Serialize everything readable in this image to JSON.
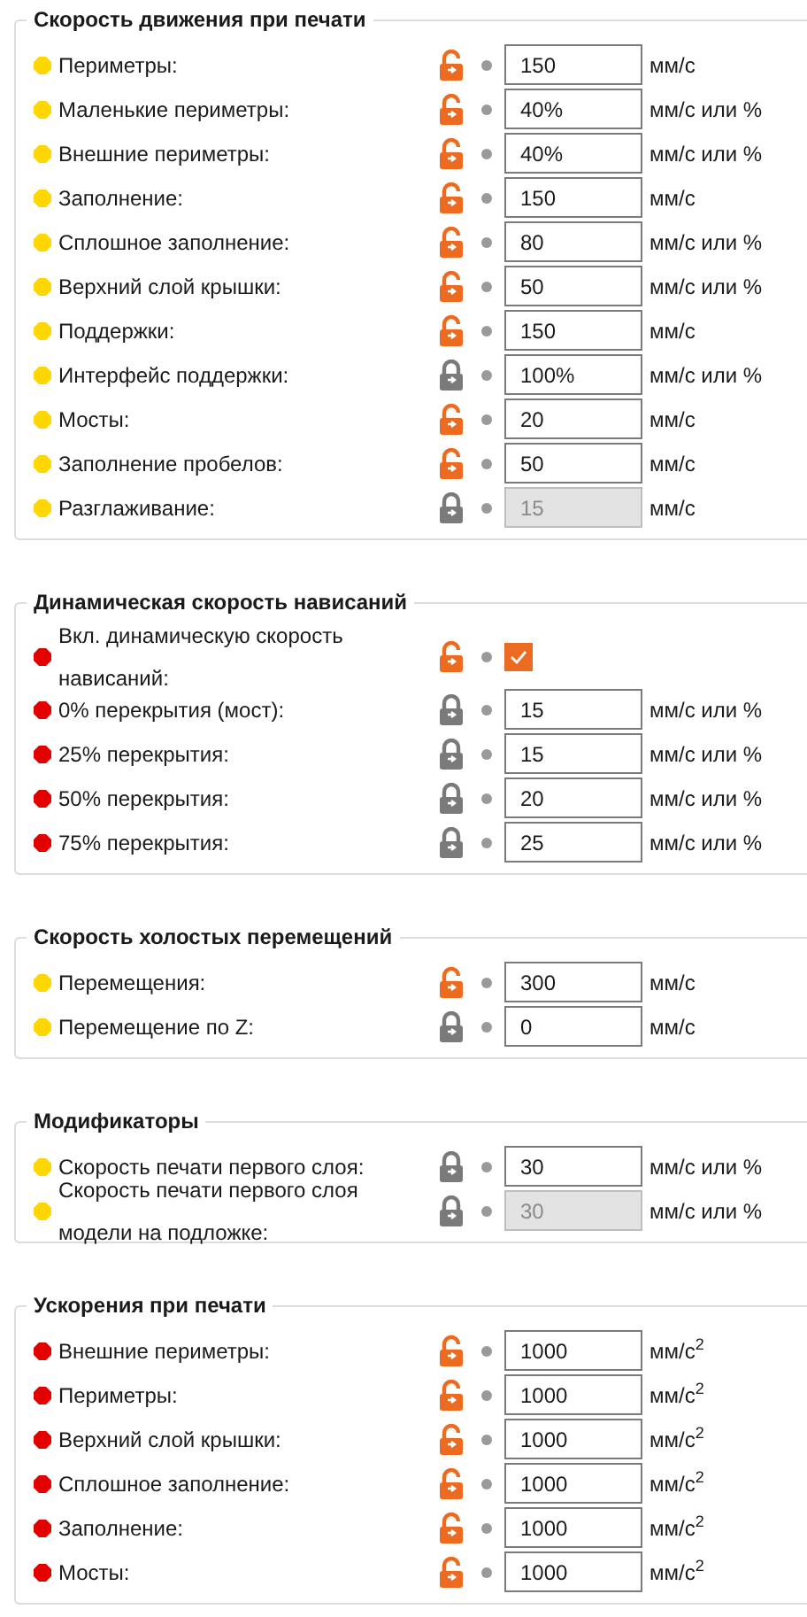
{
  "sections": [
    {
      "title": "Скорость движения при печати",
      "rows": [
        {
          "kind": "field",
          "label": "Периметры:",
          "color": "#ffd700",
          "locked": false,
          "value": "150",
          "disabled": false,
          "unit": "мм/с"
        },
        {
          "kind": "field",
          "label": "Маленькие периметры:",
          "color": "#ffd700",
          "locked": false,
          "value": "40%",
          "disabled": false,
          "unit": "мм/с или %"
        },
        {
          "kind": "field",
          "label": "Внешние периметры:",
          "color": "#ffd700",
          "locked": false,
          "value": "40%",
          "disabled": false,
          "unit": "мм/с или %"
        },
        {
          "kind": "field",
          "label": "Заполнение:",
          "color": "#ffd700",
          "locked": false,
          "value": "150",
          "disabled": false,
          "unit": "мм/с"
        },
        {
          "kind": "field",
          "label": "Сплошное заполнение:",
          "color": "#ffd700",
          "locked": false,
          "value": "80",
          "disabled": false,
          "unit": "мм/с или %"
        },
        {
          "kind": "field",
          "label": "Верхний слой крышки:",
          "color": "#ffd700",
          "locked": false,
          "value": "50",
          "disabled": false,
          "unit": "мм/с или %"
        },
        {
          "kind": "field",
          "label": "Поддержки:",
          "color": "#ffd700",
          "locked": false,
          "value": "150",
          "disabled": false,
          "unit": "мм/с"
        },
        {
          "kind": "field",
          "label": "Интерфейс поддержки:",
          "color": "#ffd700",
          "locked": true,
          "value": "100%",
          "disabled": false,
          "unit": "мм/с или %"
        },
        {
          "kind": "field",
          "label": "Мосты:",
          "color": "#ffd700",
          "locked": false,
          "value": "20",
          "disabled": false,
          "unit": "мм/с"
        },
        {
          "kind": "field",
          "label": "Заполнение пробелов:",
          "color": "#ffd700",
          "locked": false,
          "value": "50",
          "disabled": false,
          "unit": "мм/с"
        },
        {
          "kind": "field",
          "label": "Разглаживание:",
          "color": "#ffd700",
          "locked": true,
          "value": "15",
          "disabled": true,
          "unit": "мм/с"
        }
      ]
    },
    {
      "title": "Динамическая скорость нависаний",
      "rows": [
        {
          "kind": "checkbox",
          "label": "Вкл. динамическую скорость нависаний:",
          "color": "#e50000",
          "locked": false,
          "checked": true
        },
        {
          "kind": "field",
          "label": "0% перекрытия (мост):",
          "color": "#e50000",
          "locked": true,
          "value": "15",
          "disabled": false,
          "unit": "мм/с или %"
        },
        {
          "kind": "field",
          "label": "25% перекрытия:",
          "color": "#e50000",
          "locked": true,
          "value": "15",
          "disabled": false,
          "unit": "мм/с или %"
        },
        {
          "kind": "field",
          "label": "50% перекрытия:",
          "color": "#e50000",
          "locked": true,
          "value": "20",
          "disabled": false,
          "unit": "мм/с или %"
        },
        {
          "kind": "field",
          "label": "75% перекрытия:",
          "color": "#e50000",
          "locked": true,
          "value": "25",
          "disabled": false,
          "unit": "мм/с или %"
        }
      ]
    },
    {
      "title": "Скорость холостых перемещений",
      "rows": [
        {
          "kind": "field",
          "label": "Перемещения:",
          "color": "#ffd700",
          "locked": false,
          "value": "300",
          "disabled": false,
          "unit": "мм/с"
        },
        {
          "kind": "field",
          "label": "Перемещение по Z:",
          "color": "#ffd700",
          "locked": true,
          "value": "0",
          "disabled": false,
          "unit": "мм/с"
        }
      ]
    },
    {
      "title": "Модификаторы",
      "rows": [
        {
          "kind": "field",
          "label": "Скорость печати первого слоя:",
          "color": "#ffd700",
          "locked": true,
          "value": "30",
          "disabled": false,
          "unit": "мм/с или %"
        },
        {
          "kind": "field",
          "label": "Скорость печати первого слоя модели на подложке:",
          "color": "#ffd700",
          "locked": true,
          "value": "30",
          "disabled": true,
          "unit": "мм/с или %"
        }
      ]
    },
    {
      "title": "Ускорения при печати",
      "rows": [
        {
          "kind": "field",
          "label": "Внешние периметры:",
          "color": "#e50000",
          "locked": false,
          "value": "1000",
          "disabled": false,
          "unit": "мм/с$^{2}$"
        },
        {
          "kind": "field",
          "label": "Периметры:",
          "color": "#e50000",
          "locked": false,
          "value": "1000",
          "disabled": false,
          "unit": "мм/с$^{2}$"
        },
        {
          "kind": "field",
          "label": "Верхний слой крышки:",
          "color": "#e50000",
          "locked": false,
          "value": "1000",
          "disabled": false,
          "unit": "мм/с$^{2}$"
        },
        {
          "kind": "field",
          "label": "Сплошное заполнение:",
          "color": "#e50000",
          "locked": false,
          "value": "1000",
          "disabled": false,
          "unit": "мм/с$^{2}$"
        },
        {
          "kind": "field",
          "label": "Заполнение:",
          "color": "#e50000",
          "locked": false,
          "value": "1000",
          "disabled": false,
          "unit": "мм/с$^{2}$"
        },
        {
          "kind": "field",
          "label": "Мосты:",
          "color": "#e50000",
          "locked": false,
          "value": "1000",
          "disabled": false,
          "unit": "мм/с$^{2}$"
        }
      ]
    }
  ]
}
